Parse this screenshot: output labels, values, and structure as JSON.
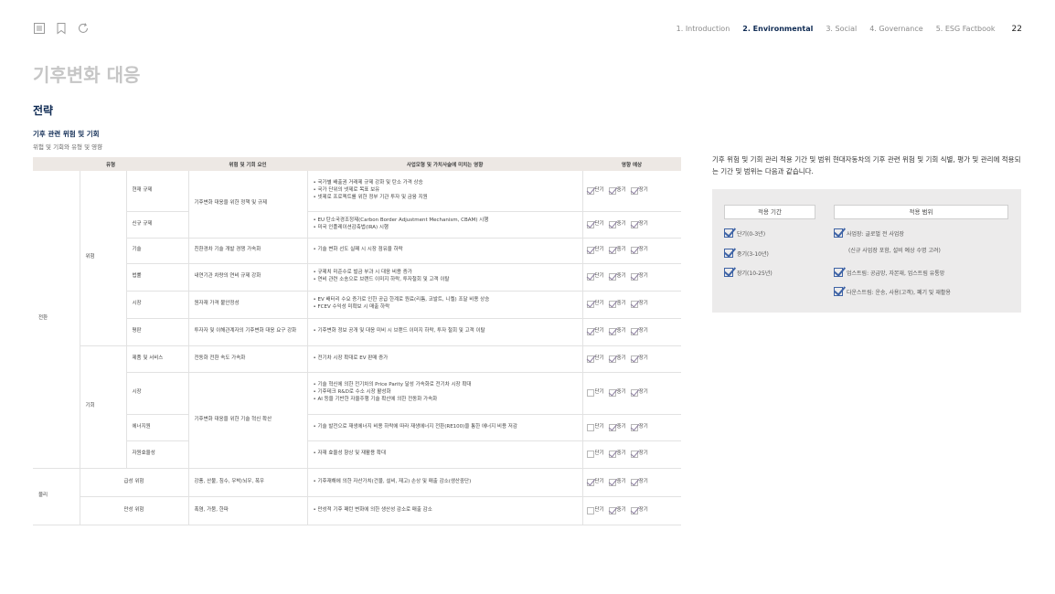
{
  "nav": {
    "items": [
      "1. Introduction",
      "2. Environmental",
      "3. Social",
      "4. Governance",
      "5. ESG Factbook"
    ],
    "page": "22"
  },
  "page": {
    "title": "기후변화 대응",
    "section": "전략",
    "subtitle": "기후 관련 위험 및 기회",
    "caption": "위험 및 기회와 유형 및 영향"
  },
  "table": {
    "headers": [
      "유형",
      "위험 및 기회 요인",
      "사업모형 및 가치사슬에 미치는 영향",
      "영향 예상"
    ],
    "check_labels": [
      "단기",
      "중기",
      "장기"
    ],
    "groups": {
      "transition": "전환",
      "physical": "물리",
      "risk": "위험",
      "opportunity": "기회"
    },
    "rows": [
      {
        "sub": "현재 규제",
        "factor": "기후변화 대응을 위한 정책 및 규제",
        "impacts": [
          "• 국가별 배출권 거래제 규제 강화 및 탄소 가격 상승",
          "• 국가 단위의 넷제로 목표 보유",
          "• 넷제로 프로젝트를 위한 정부 기관 투자 및 금융 지원"
        ],
        "checks": [
          true,
          true,
          true
        ]
      },
      {
        "sub": "신규 규제",
        "factor": "",
        "impacts": [
          "• EU 탄소국경조정제(Carbon Border Adjustment Mechanism, CBAM) 시행",
          "• 미국 인플레이션감축법(IRA) 시행"
        ],
        "checks": [
          true,
          true,
          true
        ]
      },
      {
        "sub": "기술",
        "factor": "친환경차 기술 개발 경쟁 가속화",
        "impacts": [
          "• 기술 변화 선도 실패 시 시장 점유율 하락"
        ],
        "checks": [
          true,
          true,
          true
        ]
      },
      {
        "sub": "법률",
        "factor": "내연기관 차량의 연비 규제 강화",
        "impacts": [
          "• 규제치 미준수로 벌금 부과 시 대응 비용 증가",
          "• 연비 관련 소송으로 브랜드 이미지 하락, 투자철회 및 고객 이탈"
        ],
        "checks": [
          true,
          true,
          true
        ]
      },
      {
        "sub": "시장",
        "factor": "원자재 가격 불안정성",
        "impacts": [
          "• EV 배터리 수요 증가로 인한 공급 한계로 원료(리튬, 코발트, 니켈) 조달 비용 상승",
          "• FCEV 수익성 미확보 시 매출 하락"
        ],
        "checks": [
          true,
          true,
          true
        ]
      },
      {
        "sub": "평판",
        "factor": "투자자 및 이해관계자의 기후변화 대응 요구 강화",
        "impacts": [
          "• 기후변화 정보 공개 및 대응 미비 시 브랜드 이미지 하락, 투자 철회 및 고객 이탈"
        ],
        "checks": [
          true,
          true,
          true
        ]
      },
      {
        "sub": "제품 및 서비스",
        "factor": "전동화 전환 속도 가속화",
        "impacts": [
          "• 전기차 시장 확대로 EV 판매 증가"
        ],
        "checks": [
          true,
          true,
          true
        ]
      },
      {
        "sub": "시장",
        "factor": "기후변화 대응을 위한 기술 혁신 확산",
        "impacts": [
          "• 기술 혁신에 의한 전기차의 Price Parity 달성 가속화로 전기차 시장 확대",
          "• 기후테크 R&D로 수소 시장 활성화",
          "• AI 등을 기반한 자율주행 기술 확산에 의한 전동화 가속화"
        ],
        "checks": [
          false,
          true,
          true
        ]
      },
      {
        "sub": "에너지원",
        "factor": "",
        "impacts": [
          "• 기술 발전으로 재생에너지 비용 하락에 따라 재생에너지 전환(RE100)을 통한 에너지 비용 저감"
        ],
        "checks": [
          false,
          true,
          true
        ]
      },
      {
        "sub": "자원효율성",
        "factor": "",
        "impacts": [
          "• 자재 효율성 향상 및 재활용 확대"
        ],
        "checks": [
          false,
          true,
          true
        ]
      },
      {
        "sub": "급성 위험",
        "factor": "강풍, 산불, 침수, 우박/뇌우, 폭우",
        "impacts": [
          "• 기후재해에 의한 자산가치(건물, 설비, 재고) 손상 및 매출 감소(생산중단)"
        ],
        "checks": [
          true,
          true,
          true
        ]
      },
      {
        "sub": "만성 위험",
        "factor": "폭염, 가뭄, 한파",
        "impacts": [
          "• 만성적 기후 패턴 변화에 의한 생산성 감소로 매출 감소"
        ],
        "checks": [
          false,
          true,
          true
        ]
      }
    ]
  },
  "side": {
    "paragraph": "기후 위험 및 기회 관리 적용 기간 및 범위    현대자동차의 기후 관련 위험 및 기회 식별, 평가 및 관리에 적용되는 기간 및 범위는 다음과 같습니다.",
    "panel": {
      "header_period": "적용 기간",
      "header_scope": "적용 범위",
      "periods": [
        "단기(0-3년)",
        "중기(3-10년)",
        "장기(10-25년)"
      ],
      "scopes": [
        "사업장: 글로벌 전 사업장",
        "업스트림: 공급망, 자본재, 업스트림 유통망",
        "다운스트림: 운송, 사용(고객), 폐기 및 재활용"
      ],
      "scope_note": "(신규 사업장 포함, 설비 예상 수명 고려)"
    }
  }
}
